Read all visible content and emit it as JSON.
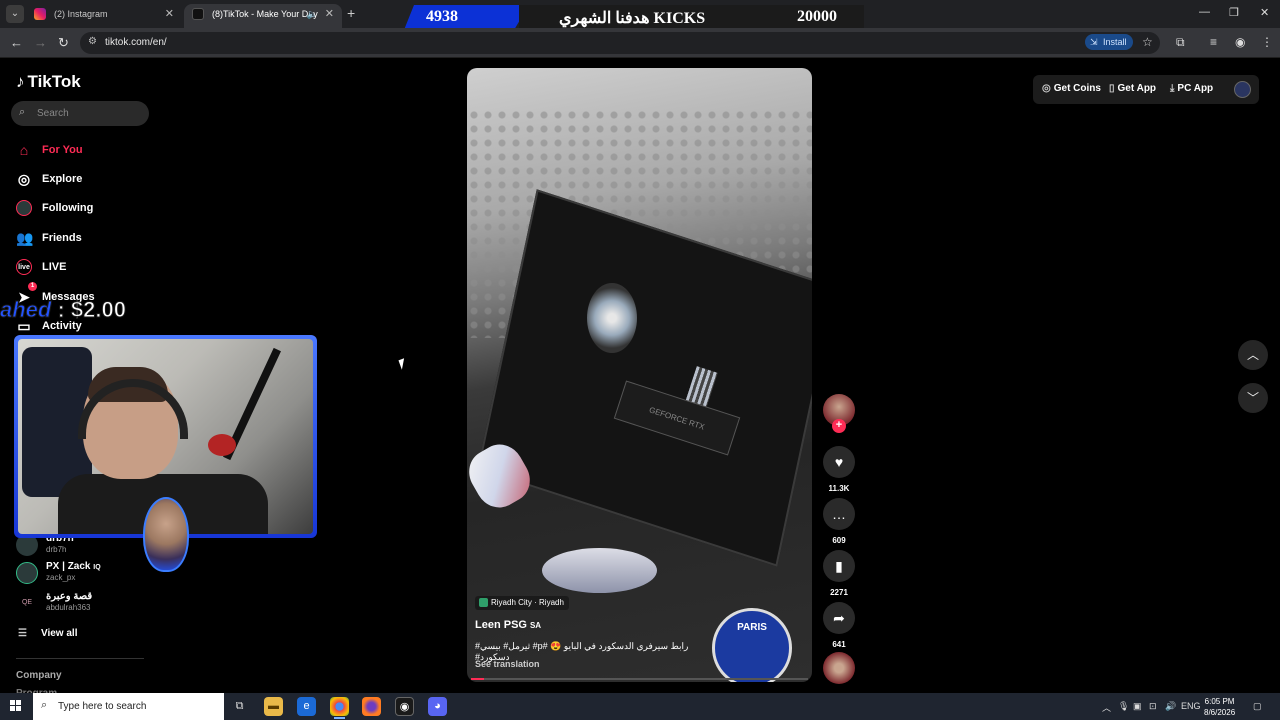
{
  "browser": {
    "tabs": [
      {
        "label": "(2) Instagram"
      },
      {
        "label": "(8)TikTok - Make Your Day"
      }
    ],
    "url": "tiktok.com/en/",
    "install_label": "Install"
  },
  "stream_overlay": {
    "left_count": "4938",
    "title": "هدفنا الشهري KICKS",
    "right_count": "20000",
    "donation_name": "ahed",
    "donation_amount": ": $2.00"
  },
  "tiktok": {
    "logo": "TikTok",
    "search_placeholder": "Search",
    "nav": [
      {
        "label": "For You",
        "icon": "home-icon"
      },
      {
        "label": "Explore",
        "icon": "compass-icon"
      },
      {
        "label": "Following",
        "icon": "following-avatar-icon"
      },
      {
        "label": "Friends",
        "icon": "friends-icon"
      },
      {
        "label": "LIVE",
        "icon": "live-icon"
      },
      {
        "label": "Messages",
        "icon": "paper-plane-icon",
        "badge": "1"
      },
      {
        "label": "Activity",
        "icon": "inbox-icon"
      }
    ],
    "following_accounts": [
      {
        "name": "drb7h",
        "handle": "drb7h"
      },
      {
        "name": "PX | Zack",
        "suffix": "IQ",
        "handle": "zack_px"
      },
      {
        "name": "قصة وعبرة",
        "handle": "abdulrah363"
      }
    ],
    "view_all": "View all",
    "company": "Company",
    "program": "Program"
  },
  "video": {
    "location": "Riyadh City · Riyadh",
    "author": "Leen PSG",
    "author_flag": "SA",
    "caption": "رابط سيرفري الدسكورد في البايو 😍 #p# ثيرمل# بيسي# دسكورد#",
    "see_translation": "See translation",
    "progress": 0.04,
    "actions": {
      "likes": "11.3K",
      "comments": "609",
      "saves": "2271",
      "shares": "641"
    }
  },
  "top_actions": {
    "get_coins": "Get Coins",
    "get_app": "Get App",
    "pc_app": "PC App"
  },
  "taskbar": {
    "search_placeholder": "Type here to search",
    "language": "ENG",
    "time": "6:05 PM",
    "date": "8/6/2026"
  },
  "colors": {
    "accent": "#fe2c55",
    "overlay_blue": "#0c31d6"
  }
}
